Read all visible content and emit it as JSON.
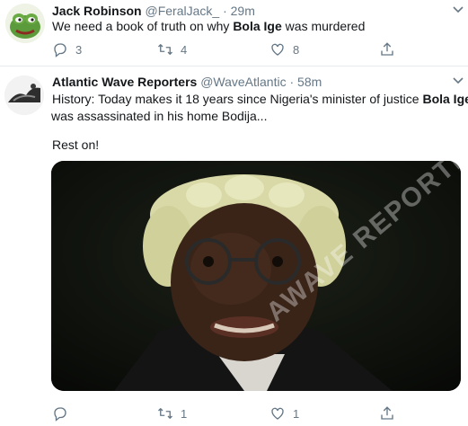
{
  "tweets": [
    {
      "name": "Jack Robinson",
      "handle": "@FeralJack_",
      "separator": "·",
      "time": "29m",
      "text_pre": "We need a book of truth on why ",
      "text_bold": "Bola Ige",
      "text_post": " was murdered",
      "reply_count": "3",
      "retweet_count": "4",
      "like_count": "8"
    },
    {
      "name": "Atlantic Wave Reporters",
      "handle": "@WaveAtlantic",
      "separator": "·",
      "time": "58m",
      "line1_pre": "History: Today makes it 18 years since Nigeria's minister of justice ",
      "line1_bold": "Bola Ige",
      "line2": "was assassinated in his home Bodija...",
      "line3": "Rest on!",
      "watermark": "AWAVE REPORTERS",
      "reply_count": "",
      "retweet_count": "1",
      "like_count": "1"
    }
  ],
  "icons": {
    "reply": "reply-icon",
    "retweet": "retweet-icon",
    "like": "heart-icon",
    "share": "share-icon",
    "more": "chevron-down-icon"
  },
  "colors": {
    "text": "#14171a",
    "secondary": "#657786",
    "divider": "#e6ecf0"
  }
}
